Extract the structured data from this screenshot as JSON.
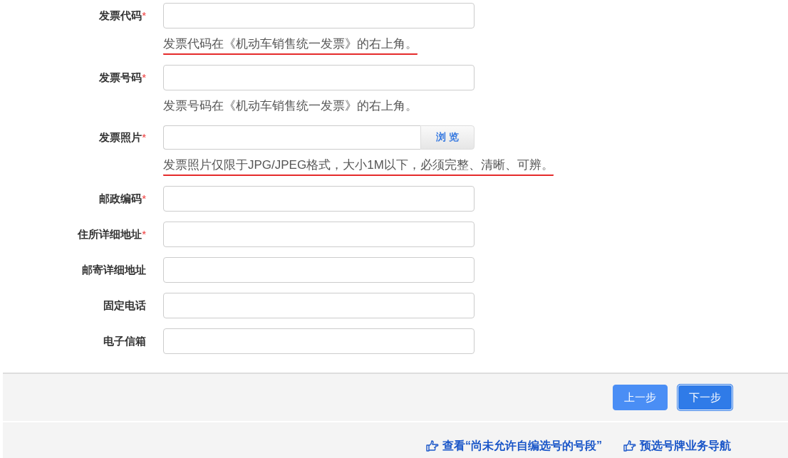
{
  "fields": [
    {
      "label": "发票代码",
      "required_mark": "*",
      "kind": "text",
      "hint": "发票代码在《机动车销售统一发票》的右上角。",
      "hint_underlined": true
    },
    {
      "label": "发票号码",
      "required_mark": "*",
      "kind": "text",
      "hint": "发票号码在《机动车销售统一发票》的右上角。",
      "hint_underlined": false
    },
    {
      "label": "发票照片",
      "required_mark": "*",
      "kind": "file",
      "button": "浏 览",
      "hint": "发票照片仅限于JPG/JPEG格式，大小1M以下，必须完整、清晰、可辨。",
      "hint_underlined": true
    },
    {
      "label": "邮政编码",
      "required_mark": "*",
      "kind": "text"
    },
    {
      "label": "住所详细地址",
      "required_mark": "*",
      "kind": "text"
    },
    {
      "label": "邮寄详细地址",
      "kind": "text"
    },
    {
      "label": "固定电话",
      "kind": "text"
    },
    {
      "label": "电子信箱",
      "kind": "text"
    }
  ],
  "buttons": [
    {
      "label": "上一步",
      "selected": false
    },
    {
      "label": "下一步",
      "selected": true
    }
  ],
  "links": [
    "查看“尚未允许自编选号的号段”",
    "预选号牌业务导航"
  ]
}
